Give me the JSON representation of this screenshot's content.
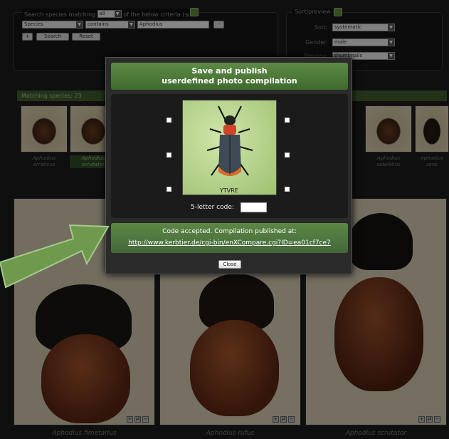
{
  "search": {
    "legend_prefix": "Search species matching",
    "match_value": "all",
    "legend_suffix": "of the below criteria (≤3)",
    "field_value": "Species",
    "operator_value": "contains",
    "query_value": "Aphodius",
    "minus_label": "-",
    "plus_label": "+",
    "search_label": "Search",
    "reset_label": "Reset"
  },
  "sort_preview": {
    "legend": "Sort/preview",
    "sort_label": "Sort:",
    "sort_value": "systematic",
    "gender_label": "Gender:",
    "gender_value": "male",
    "preview_label": "Preview:",
    "preview_value": "thumbnails"
  },
  "results": {
    "matching_label": "Matching species: 23",
    "thumbnails": [
      {
        "line1": "Aphodius",
        "line2": "erraticus"
      },
      {
        "line1": "Aphodius",
        "line2": "scrutator"
      },
      {
        "line1": "Aphodius",
        "line2": "satellitius"
      },
      {
        "line1": "Aphodius",
        "line2": "zenk"
      }
    ]
  },
  "compare": {
    "captions": [
      "Aphodius fimetarius",
      "Aphodius rufus",
      "Aphodius scrutator"
    ]
  },
  "modal": {
    "title_line1": "Save and publish",
    "title_line2": "userdefined photo compilation",
    "captcha_text": "YTVRE",
    "code_label": "5-letter code:",
    "accepted_text": "Code accepted. Compilation published at:",
    "published_url": "http://www.kerbtier.de/cgi-bin/enXCompare.cgi?ID=ea01cf7ce7",
    "close_label": "Close"
  },
  "colors": {
    "accent_green": "#5e8a46",
    "arrow_green": "#6f9a4e",
    "link": "#ffffff"
  }
}
